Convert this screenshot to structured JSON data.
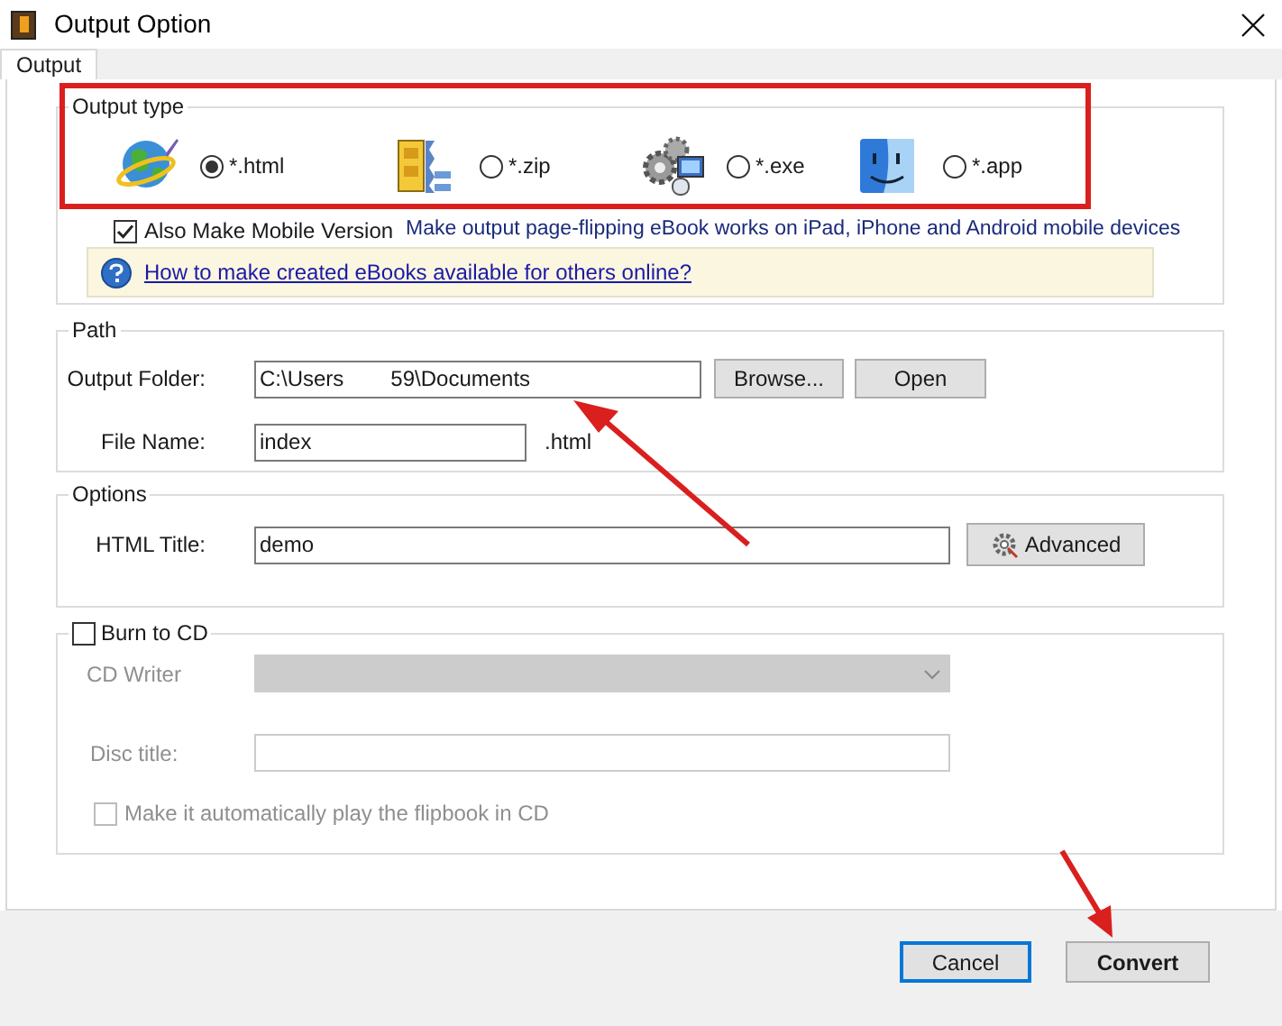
{
  "window": {
    "title": "Output Option"
  },
  "tabs": [
    {
      "label": "Output",
      "selected": true
    }
  ],
  "output_type": {
    "legend": "Output type",
    "options": [
      {
        "kind": "globe",
        "label": "*.html",
        "selected": true
      },
      {
        "kind": "archive",
        "label": "*.zip",
        "selected": false
      },
      {
        "kind": "gears",
        "label": "*.exe",
        "selected": false
      },
      {
        "kind": "finder",
        "label": "*.app",
        "selected": false
      }
    ]
  },
  "mobile": {
    "label": "Also Make Mobile Version",
    "checked": true,
    "note": "Make output page-flipping eBook works on iPad, iPhone and Android mobile devices"
  },
  "info": {
    "link": "How to make created eBooks available for others online?"
  },
  "path": {
    "legend": "Path",
    "output_folder": {
      "label": "Output Folder:",
      "value_start": "C:\\Users",
      "value_end": "59\\Documents"
    },
    "browse": "Browse...",
    "open": "Open",
    "file_name": {
      "label": "File Name:",
      "value": "index",
      "suffix": ".html"
    }
  },
  "options": {
    "legend": "Options",
    "html_title": {
      "label": "HTML Title:",
      "value": "demo"
    },
    "advanced": "Advanced"
  },
  "burn": {
    "label": "Burn to CD",
    "checked": false,
    "disabled": true,
    "cd_writer": "CD Writer",
    "disc_title": "Disc title:",
    "autoplay": {
      "label": "Make it automatically play the flipbook in CD",
      "checked": false
    }
  },
  "buttons": [
    {
      "label": "Cancel",
      "kind": "focused"
    },
    {
      "label": "Convert",
      "kind": "default"
    }
  ]
}
